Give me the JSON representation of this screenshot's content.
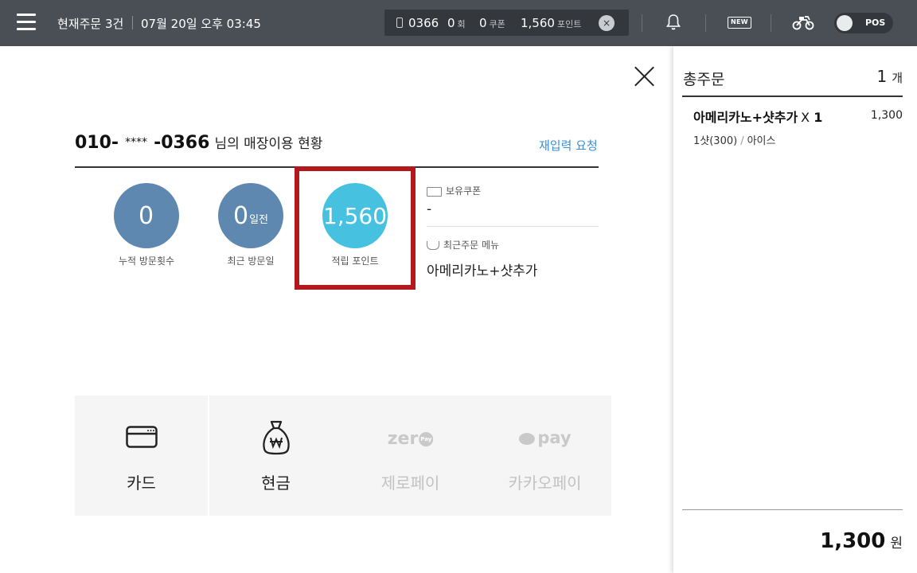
{
  "header": {
    "current_orders": "현재주문 3건",
    "datetime": "07월 20일 오후 03:45",
    "customer": {
      "phone_last4": "0366",
      "visits": "0",
      "visits_unit": "회",
      "coupons": "0",
      "coupons_unit": "쿠폰",
      "points": "1,560",
      "points_unit": "포인트",
      "clear_label": "×"
    },
    "new_badge": "NEW",
    "pos_label": "POS"
  },
  "customer_status": {
    "phone_prefix": "010-",
    "phone_mask": "****",
    "phone_suffix": "-0366",
    "suffix_text": "님의 매장이용 현황",
    "reentry_label": "재입력 요청",
    "stats": [
      {
        "value": "0",
        "suffix": "",
        "label": "누적 방문횟수"
      },
      {
        "value": "0",
        "suffix": "일전",
        "label": "최근 방문일"
      },
      {
        "value": "1,560",
        "suffix": "",
        "label": "적립 포인트"
      }
    ],
    "coupon_title": "보유쿠폰",
    "coupon_value": "-",
    "recent_menu_title": "최근주문 메뉴",
    "recent_menu_value": "아메리카노+샷추가"
  },
  "payment_methods": [
    {
      "label": "카드",
      "icon": "card-icon",
      "enabled": true
    },
    {
      "label": "현금",
      "icon": "cash-bag-icon",
      "enabled": true
    },
    {
      "label": "제로페이",
      "icon": "zeropay-logo",
      "logo_text": "zer",
      "logo_badge": "Pay",
      "enabled": false
    },
    {
      "label": "카카오페이",
      "icon": "kakaopay-logo",
      "logo_text": "pay",
      "enabled": false
    }
  ],
  "order_summary": {
    "title": "총주문",
    "count": "1",
    "count_unit": "개",
    "items": [
      {
        "name": "아메리카노+샷추가",
        "qty_prefix": "X",
        "qty": "1",
        "price": "1,300",
        "option1": "1샷(300)",
        "option_sep": "/",
        "option2": "아이스"
      }
    ],
    "total": "1,300",
    "total_unit": "원"
  },
  "colors": {
    "header_bg": "#4a4f55",
    "stat_circle": "#5e88b0",
    "points_circle": "#47c1e0",
    "highlight_border": "#b3181c",
    "link": "#3a8fd6"
  }
}
